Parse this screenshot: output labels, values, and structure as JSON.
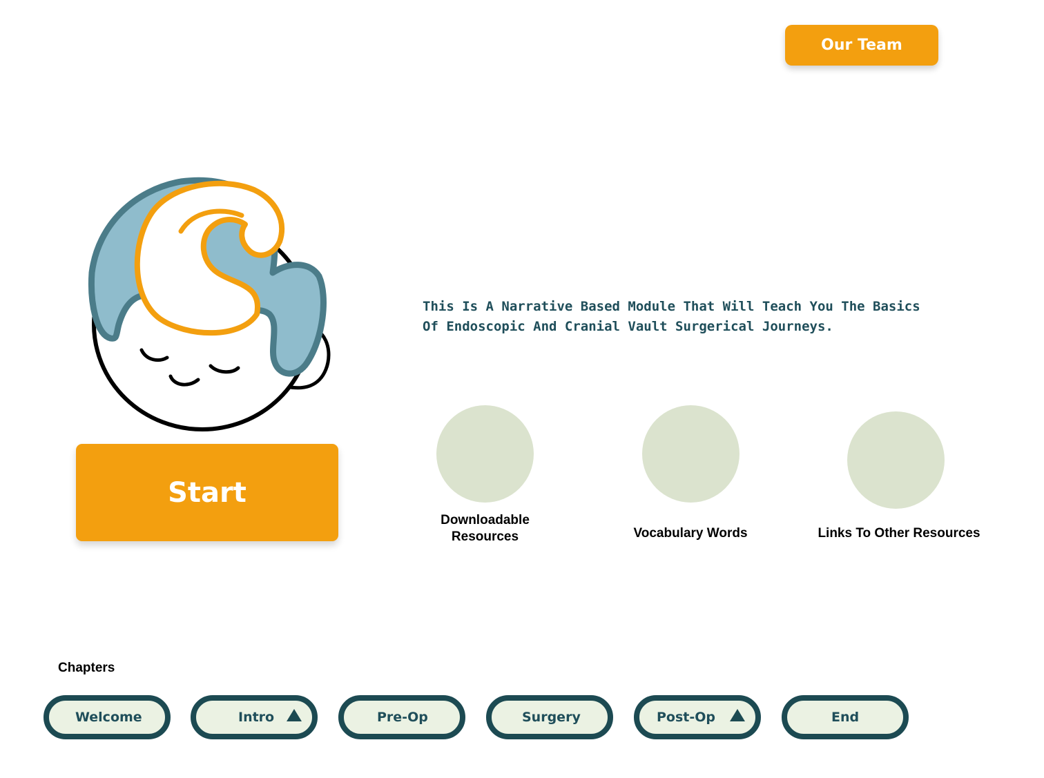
{
  "header": {
    "team_button_label": "Our Team"
  },
  "hero": {
    "start_button_label": "Start",
    "tagline_line1": "This Is A Narrative Based Module That Will Teach You The Basics",
    "tagline_line2": "Of Endoscopic And Cranial Vault Surgerical Journeys."
  },
  "resources": [
    {
      "label_line1": "Downloadable",
      "label_line2": "Resources"
    },
    {
      "label_line1": "Vocabulary Words"
    },
    {
      "label_line1": "Links To Other Resources"
    }
  ],
  "chapters": {
    "heading": "Chapters",
    "items": [
      {
        "label": "Welcome",
        "has_arrow": false
      },
      {
        "label": "Intro",
        "has_arrow": true
      },
      {
        "label": "Pre-Op",
        "has_arrow": false
      },
      {
        "label": "Surgery",
        "has_arrow": false
      },
      {
        "label": "Post-Op",
        "has_arrow": true
      },
      {
        "label": "End",
        "has_arrow": false
      }
    ]
  },
  "colors": {
    "accent_orange": "#F39F0F",
    "teal_dark": "#1C4A52",
    "text_teal": "#1F4E5A",
    "chip_fill": "#EBF2E3",
    "resource_circle": "#DBE3CE",
    "logo_hair_fill": "#8FBCCC",
    "logo_hair_stroke": "#4B7C89"
  },
  "icons": {
    "logo": "baby-head-logo-icon",
    "chapter_arrow": "triangle-up-icon"
  }
}
